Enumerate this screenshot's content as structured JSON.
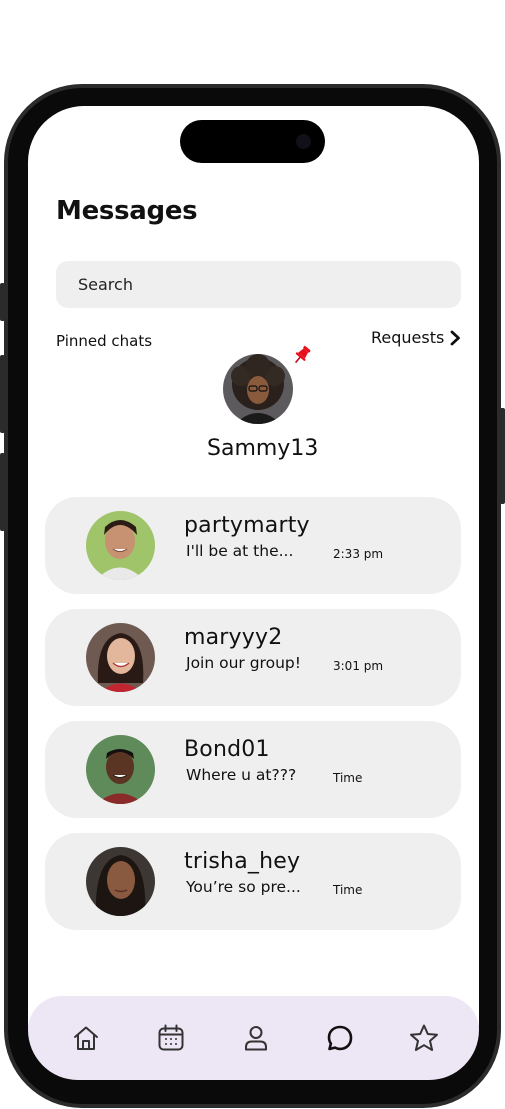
{
  "header": {
    "title": "Messages"
  },
  "search": {
    "placeholder": "Search"
  },
  "pinned": {
    "label": "Pinned chats",
    "requests_label": "Requests",
    "user": {
      "name": "Sammy13",
      "avatar_icon": "avatar-photo",
      "pin_icon": "pushpin-icon"
    }
  },
  "chats": [
    {
      "name": "partymarty",
      "message": "I'll be at the...",
      "time": "2:33 pm"
    },
    {
      "name": "maryyy2",
      "message": "Join our group!",
      "time": "3:01 pm"
    },
    {
      "name": "Bond01",
      "message": "Where u at???",
      "time": "Time"
    },
    {
      "name": "trisha_hey",
      "message": "You’re so pre...",
      "time": "Time"
    }
  ],
  "tabbar": {
    "tabs": [
      {
        "icon": "home-icon",
        "active": false
      },
      {
        "icon": "calendar-icon",
        "active": false
      },
      {
        "icon": "profile-icon",
        "active": false
      },
      {
        "icon": "chat-bubble-icon",
        "active": true
      },
      {
        "icon": "star-icon",
        "active": false
      }
    ]
  },
  "colors": {
    "card_bg": "#efefef",
    "tabbar_bg": "#ece6f5",
    "pin": "#e8101a",
    "text": "#111111"
  }
}
